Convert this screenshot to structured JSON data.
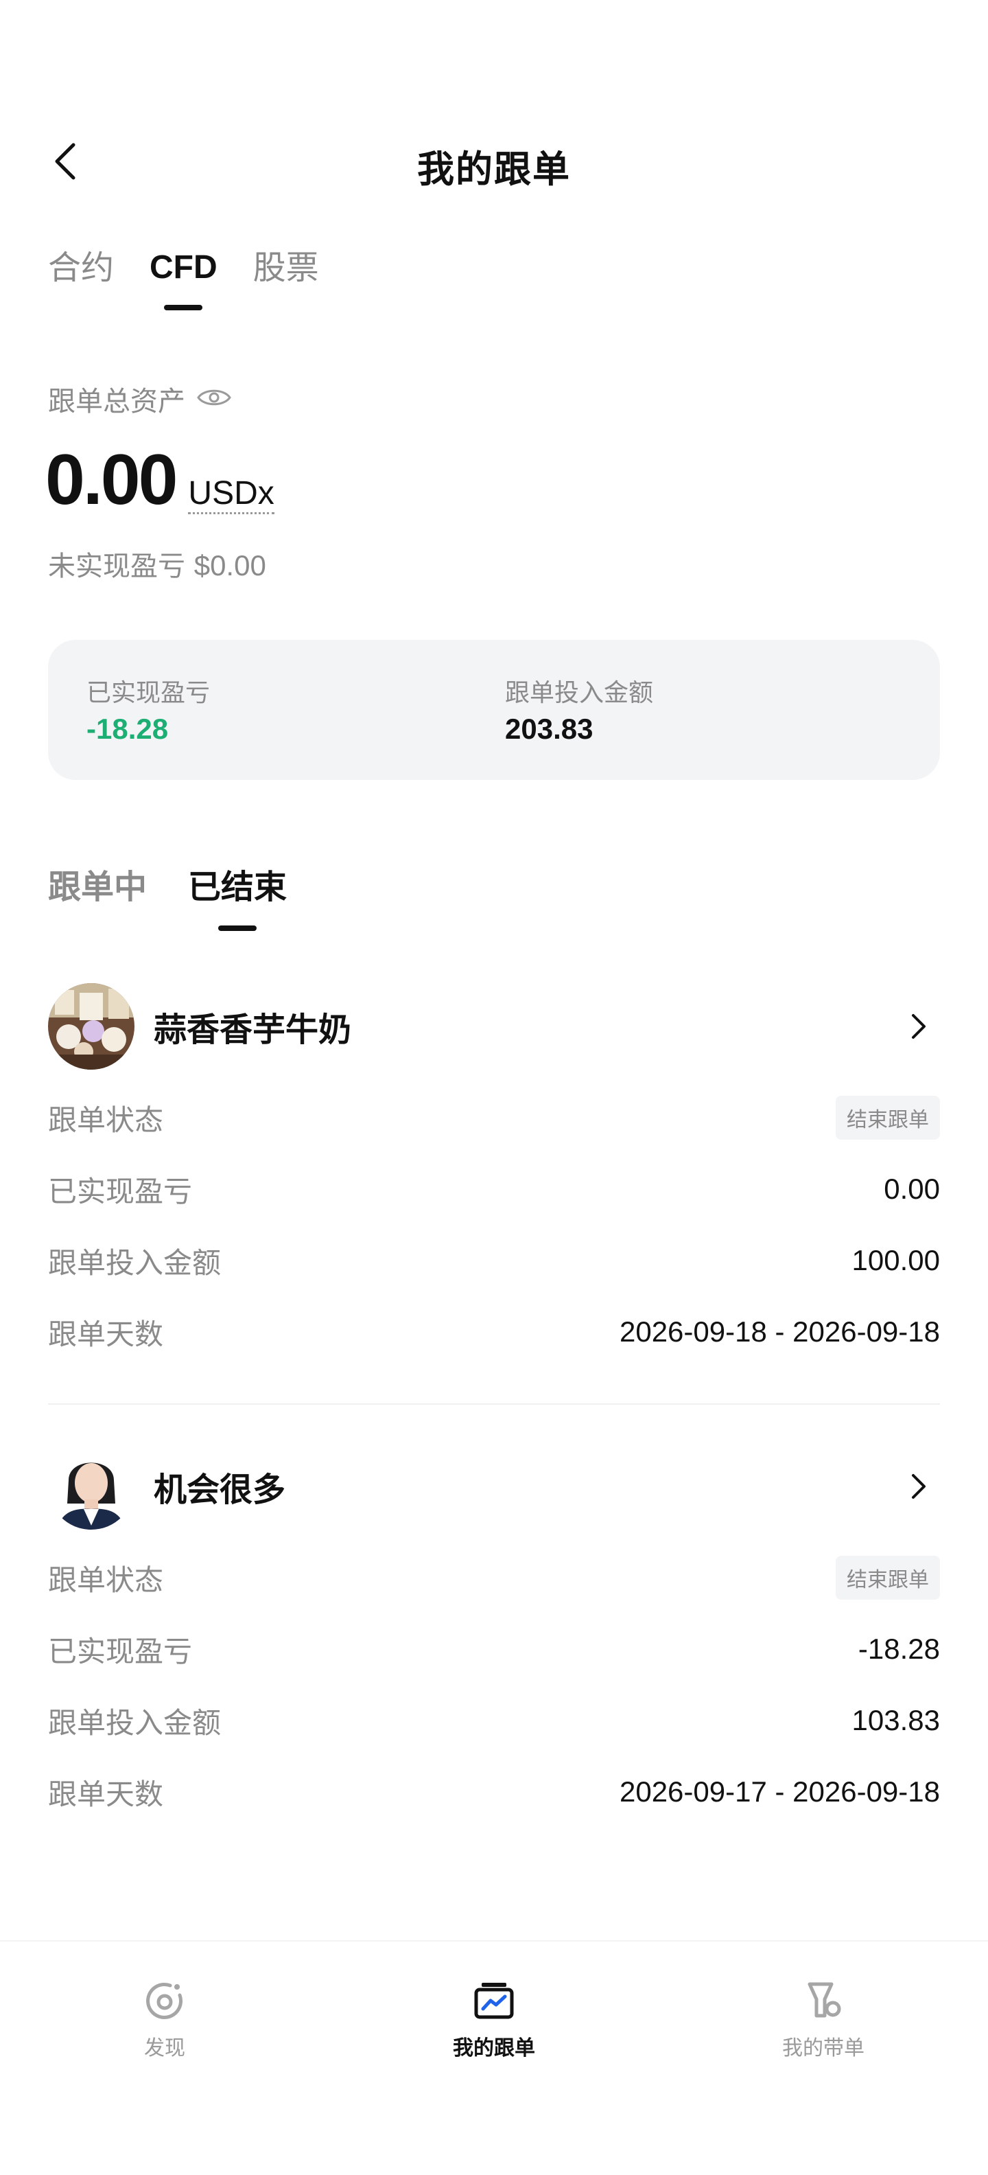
{
  "header": {
    "title": "我的跟单"
  },
  "top_tabs": [
    {
      "label": "合约",
      "active": false
    },
    {
      "label": "CFD",
      "active": true
    },
    {
      "label": "股票",
      "active": false
    }
  ],
  "assets": {
    "label": "跟单总资产",
    "value": "0.00",
    "unit": "USDx",
    "unrealized_label": "未实现盈亏",
    "unrealized_value": "$0.00"
  },
  "summary": {
    "realized_label": "已实现盈亏",
    "realized_value": "-18.28",
    "invested_label": "跟单投入金额",
    "invested_value": "203.83"
  },
  "sub_tabs": [
    {
      "label": "跟单中",
      "active": false
    },
    {
      "label": "已结束",
      "active": true
    }
  ],
  "traders": [
    {
      "name": "蒜香香芋牛奶",
      "status_label": "跟单状态",
      "status_value": "结束跟单",
      "realized_label": "已实现盈亏",
      "realized_value": "0.00",
      "invested_label": "跟单投入金额",
      "invested_value": "100.00",
      "days_label": "跟单天数",
      "days_value": "2026-09-18 - 2026-09-18"
    },
    {
      "name": "机会很多",
      "status_label": "跟单状态",
      "status_value": "结束跟单",
      "realized_label": "已实现盈亏",
      "realized_value": "-18.28",
      "invested_label": "跟单投入金额",
      "invested_value": "103.83",
      "days_label": "跟单天数",
      "days_value": "2026-09-17 - 2026-09-18"
    }
  ],
  "bottom_nav": [
    {
      "label": "发现",
      "icon": "discover-icon",
      "active": false
    },
    {
      "label": "我的跟单",
      "icon": "copy-trade-icon",
      "active": true
    },
    {
      "label": "我的带单",
      "icon": "lead-trade-icon",
      "active": false
    }
  ],
  "colors": {
    "profit_negative": "#1dae74",
    "text": "#111111",
    "muted": "#8a8a8a",
    "card": "#f3f4f6"
  }
}
